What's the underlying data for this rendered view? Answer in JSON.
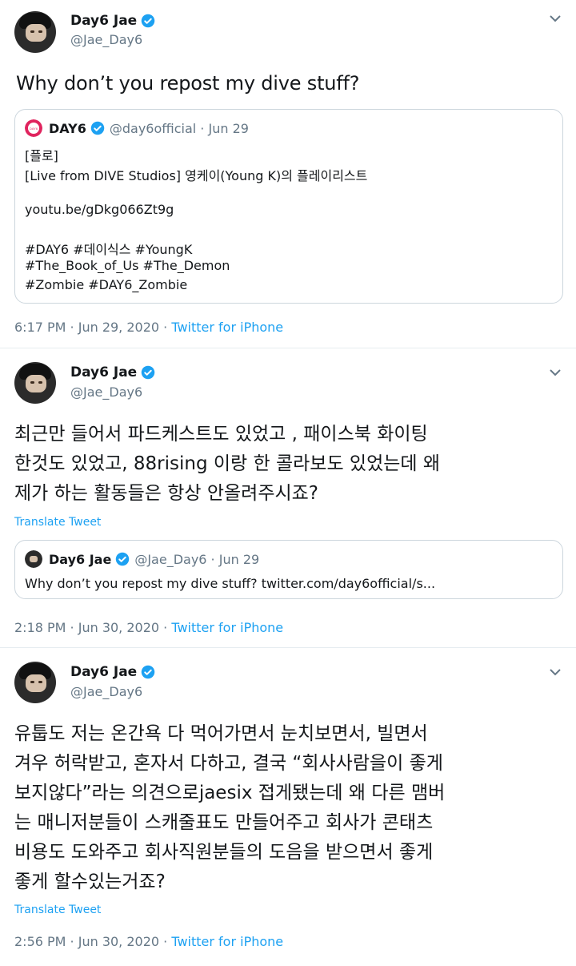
{
  "tweets": [
    {
      "display_name": "Day6 Jae",
      "handle": "@Jae_Day6",
      "text": "Why don’t you repost my dive stuff?",
      "quoted": {
        "display_name": "DAY6",
        "handle_date": "@day6official · Jun 29",
        "lines": [
          "[플로]",
          "[Live from DIVE Studios] 영케이(Young K)의 플레이리스트",
          "youtu.be/gDkg066Zt9g",
          "#DAY6 #데이식스 #YoungK",
          "#The_Book_of_Us #The_Demon",
          "#Zombie #DAY6_Zombie"
        ]
      },
      "time_date": "6:17 PM · Jun 29, 2020 · ",
      "client": "Twitter for iPhone"
    },
    {
      "display_name": "Day6 Jae",
      "handle": "@Jae_Day6",
      "text_lines": [
        "최근만 들어서 파드케스트도 있었고 , 패이스북 화이팅",
        "한것도 있었고, 88rising 이랑 한 콜라보도 있었는데 왜",
        "제가 하는 활동들은 항상 안올려주시죠?"
      ],
      "translate": "Translate Tweet",
      "quoted": {
        "display_name": "Day6 Jae",
        "handle_date": "@Jae_Day6 · Jun 29",
        "text": "Why don’t you repost my dive stuff? twitter.com/day6official/s..."
      },
      "time_date": "2:18 PM · Jun 30, 2020 · ",
      "client": "Twitter for iPhone"
    },
    {
      "display_name": "Day6 Jae",
      "handle": "@Jae_Day6",
      "text_lines": [
        "유툽도 저는 온간욕 다 먹어가면서 눈치보면서, 빌면서",
        "겨우 허락받고, 혼자서 다하고, 결국 “회사사람을이 좋게",
        "보지않다”라는 의견으로jaesix 접게됐는데 왜 다른 맴버",
        "는 매니저분들이 스캐줄표도 만들어주고 회사가 콘태츠",
        "비용도 도와주고 회사직원분들의 도음을 받으면서 좋게",
        "좋게 할수있는거죠?"
      ],
      "translate": "Translate Tweet",
      "time_date": "2:56 PM · Jun 30, 2020 · ",
      "client": "Twitter for iPhone"
    }
  ],
  "colors": {
    "link": "#1da1f2",
    "secondary": "#657786",
    "border": "#ccd6dd",
    "divider": "#e6ecf0"
  },
  "icons": [
    "verified-badge-icon",
    "chevron-down-icon",
    "avatar"
  ]
}
